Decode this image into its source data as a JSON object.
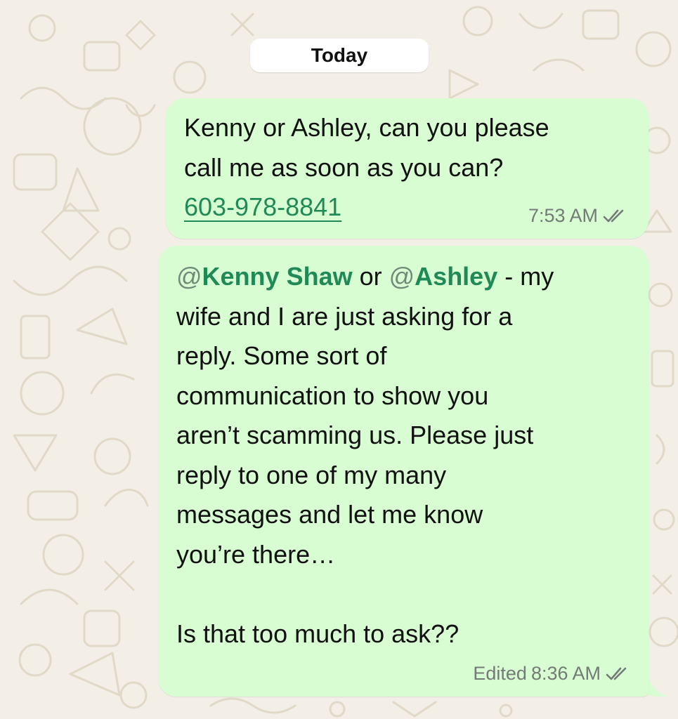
{
  "date_separator": "Today",
  "colors": {
    "wallpaper": "#f3efe7",
    "outgoing_bubble": "#d9fdd3",
    "link_green": "#1f8a56",
    "meta_gray": "#727b76"
  },
  "messages": [
    {
      "text_before": "Kenny or Ashley, can you please\ncall me as soon as you can?",
      "phone_link": "603-978-8841",
      "edited_label": "",
      "time": "7:53 AM",
      "status_icon": "double-check-icon"
    },
    {
      "mention1_at": "@",
      "mention1_name": "Kenny Shaw",
      "between_mentions": " or ",
      "mention2_at": "@",
      "mention2_name": "Ashley",
      "text_after": "  - my\nwife and I are just asking for a\nreply. Some sort of\ncommunication to show you\naren’t scamming us. Please just\nreply to one of my many\nmessages and let me know\nyou’re there…\n\nIs that too much to ask??",
      "edited_label": "Edited",
      "time": "8:36 AM",
      "status_icon": "double-check-icon"
    }
  ]
}
